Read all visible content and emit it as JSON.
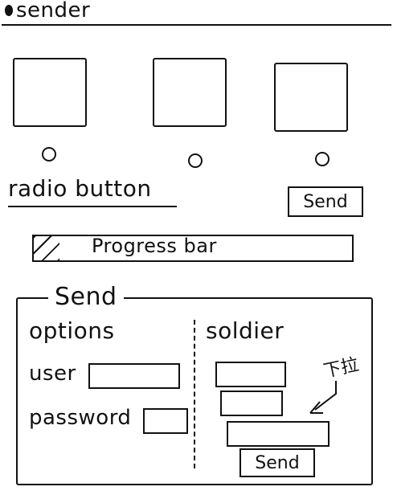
{
  "window": {
    "title": "sender"
  },
  "radio_section": {
    "options": [
      {
        "selected": false
      },
      {
        "selected": false
      },
      {
        "selected": false
      }
    ],
    "label": "radio button"
  },
  "send_button_top": {
    "label": "Send"
  },
  "progress": {
    "label": "Progress bar",
    "value": 0.08
  },
  "send_panel": {
    "legend": "Send",
    "options": {
      "heading": "options",
      "user_label": "user",
      "user_value": "",
      "password_label": "password",
      "password_value": ""
    },
    "soldier": {
      "heading": "soldier",
      "fields": [
        {
          "value": ""
        },
        {
          "value": ""
        }
      ],
      "wide_field": {
        "value": ""
      },
      "annotation": "下拉"
    },
    "send_button": {
      "label": "Send"
    }
  }
}
